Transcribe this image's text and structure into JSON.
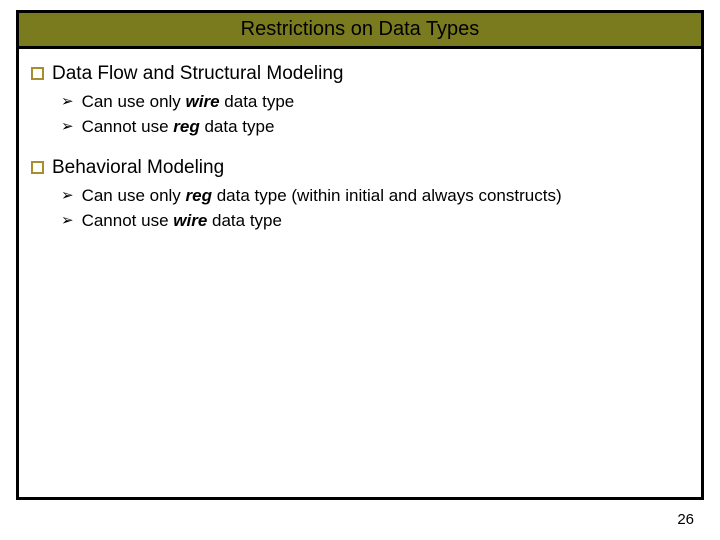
{
  "title": "Restrictions on Data Types",
  "sections": [
    {
      "heading": "Data Flow and Structural Modeling",
      "items": [
        {
          "pre": "Can use only ",
          "kw": "wire",
          "post": " data type"
        },
        {
          "pre": "Cannot use ",
          "kw": "reg",
          "post": " data type"
        }
      ]
    },
    {
      "heading": "Behavioral Modeling",
      "items": [
        {
          "pre": "Can use only ",
          "kw": "reg",
          "post": " data type (within initial and always constructs)"
        },
        {
          "pre": "Cannot use ",
          "kw": "wire",
          "post": " data type"
        }
      ]
    }
  ],
  "pageNumber": "26"
}
